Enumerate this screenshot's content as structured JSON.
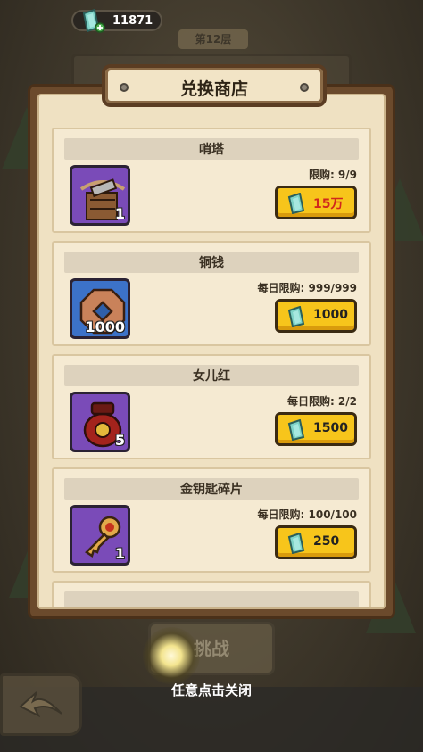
{
  "currency": {
    "amount": "11871",
    "icon": "jade-ticket-icon"
  },
  "shop": {
    "title": "兑换商店"
  },
  "items": [
    {
      "name": "哨塔",
      "count": "1",
      "icon": "crossbow-tower-icon",
      "frame": "purple",
      "limit": "限购: 9/9",
      "price": "15万",
      "price_color": "#d1271c"
    },
    {
      "name": "铜钱",
      "count": "1000",
      "icon": "copper-coin-icon",
      "frame": "blue",
      "limit": "每日限购: 999/999",
      "price": "1000",
      "price_color": "#222222"
    },
    {
      "name": "女儿红",
      "count": "5",
      "icon": "wine-jar-icon",
      "frame": "purple",
      "limit": "每日限购: 2/2",
      "price": "1500",
      "price_color": "#222222"
    },
    {
      "name": "金钥匙碎片",
      "count": "1",
      "icon": "golden-key-fragment-icon",
      "frame": "purple",
      "limit": "每日限购: 100/100",
      "price": "250",
      "price_color": "#222222"
    }
  ],
  "background": {
    "floor_label": "第12层",
    "challenge_button": "挑战"
  },
  "close_hint": "任意点击关闭",
  "colors": {
    "buy_button": "#f7c51b",
    "panel_frame": "#6b4a2c",
    "panel_paper": "#efe1c2"
  }
}
